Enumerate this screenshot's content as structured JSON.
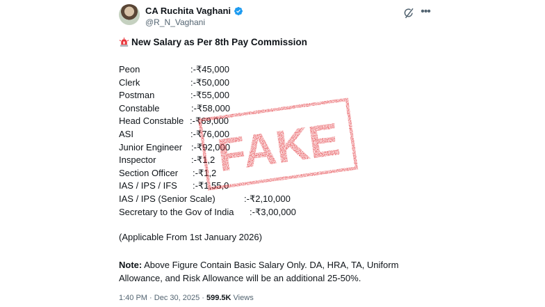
{
  "author": {
    "display_name": "CA Ruchita Vaghani",
    "handle": "@R_N_Vaghani"
  },
  "tweet": {
    "headline": "New Salary as Per 8th Pay Commission",
    "salaries": [
      {
        "post": "Peon",
        "pay": ":-₹45,000"
      },
      {
        "post": "Clerk",
        "pay": ":-₹50,000"
      },
      {
        "post": "Postman",
        "pay": ":-₹55,000"
      },
      {
        "post": "Constable",
        "pay": ":-₹58,000"
      },
      {
        "post": "Head Constable",
        "pay": ":-₹69,000"
      },
      {
        "post": "ASI",
        "pay": ":-₹76,000"
      },
      {
        "post": "Junior Engineer",
        "pay": ":-₹92,000"
      },
      {
        "post": "Inspector",
        "pay": ":-₹1,2"
      },
      {
        "post": "Section Officer",
        "pay": ":-₹1,2"
      },
      {
        "post": "IAS / IPS / IFS",
        "pay": ":-₹1,55,0"
      },
      {
        "post": "IAS / IPS (Senior Scale)",
        "pay": ":-₹2,10,000"
      },
      {
        "post": "Secretary to the Gov of India",
        "pay": ":-₹3,00,000"
      }
    ],
    "applicable": "(Applicable From 1st January 2026)",
    "note_label": "Note:",
    "note_text": " Above Figure Contain Basic Salary Only. DA, HRA, TA, Uniform Allowance, and Risk Allowance will be an additional 25-50%.",
    "time": "1:40 PM",
    "date": "Dec 30, 2025",
    "views_count": "599.5K",
    "views_label": "Views"
  },
  "stamp": {
    "text": "FAKE",
    "color": "#e0232a"
  },
  "colors": {
    "verified": "#1d9bf0",
    "secondary_text": "#536471",
    "primary_text": "#0f1419"
  },
  "icons": {
    "verified": "verified-badge-icon",
    "grok": "grok-icon",
    "more": "more-icon",
    "siren": "siren-emoji-icon"
  }
}
